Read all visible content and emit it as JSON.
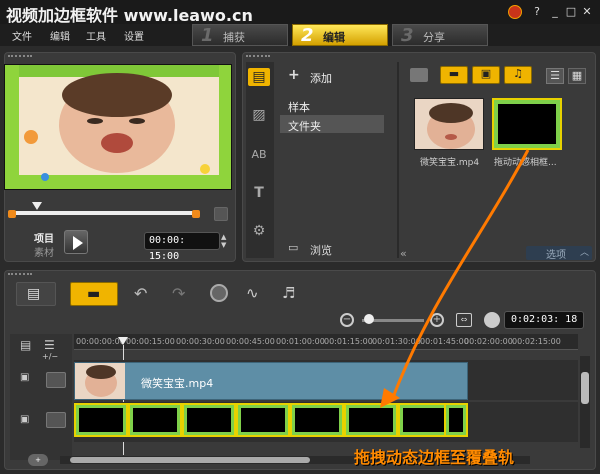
{
  "window": {
    "title": "视频加边框软件 www.leawo.cn"
  },
  "menu": {
    "file": "文件",
    "edit": "编辑",
    "tools": "工具",
    "settings": "设置"
  },
  "steps": [
    {
      "num": "1",
      "label": "捕获"
    },
    {
      "num": "2",
      "label": "编辑"
    },
    {
      "num": "3",
      "label": "分享"
    }
  ],
  "preview": {
    "project_label": "项目",
    "clip_label": "素材",
    "timecode": "00:00: 15:00"
  },
  "library": {
    "add_label": "添加",
    "folders": [
      "样本",
      "文件夹"
    ],
    "browse_label": "浏览",
    "options_label": "选项",
    "thumbs": [
      {
        "caption": "微笑宝宝.mp4"
      },
      {
        "caption": "拖动动感相框..."
      }
    ]
  },
  "timeline": {
    "timecode": "0:02:03: 18",
    "ruler": [
      "00:00:00:00",
      "00:00:15:00",
      "00:00:30:00",
      "00:00:45:00",
      "00:01:00:00",
      "00:01:15:00",
      "00:01:30:00",
      "00:01:45:00",
      "00:02:00:00",
      "00:02:15:00"
    ],
    "video_clip_title": "微笑宝宝.mp4"
  },
  "annotation": {
    "text": "拖拽动态边框至覆叠轨"
  }
}
